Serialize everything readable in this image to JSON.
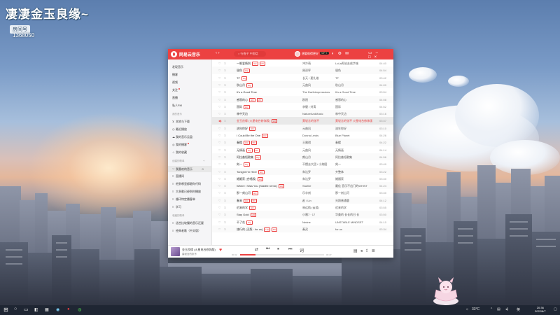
{
  "overlay": {
    "stream_title": "凄凄金玉良缘~",
    "room_label": "房间号",
    "room_number": "1368050"
  },
  "app": {
    "name": "网易云音乐",
    "search_placeholder": "○ 行香子 中国话",
    "user_name": "想要做得更好",
    "vip": "VIP 7",
    "brand_color": "#ec4141"
  },
  "sidebar": {
    "top_items": [
      "发现音乐",
      "播客",
      "视频",
      "关注",
      "直播",
      "私人FM"
    ],
    "mine_header": "我的音乐",
    "mine_items": [
      "本地与下载",
      "最近播放",
      "我的音乐云盘",
      "我的播客",
      "我的收藏"
    ],
    "created_header": "创建的歌单",
    "created_items": [
      "我喜欢的音乐",
      "直播间",
      "他到哪里都跟你代码",
      "大多歌已经到时播放",
      "循环特定播客单",
      "学习"
    ],
    "collected_header": "收藏的歌单",
    "collected_items": [
      "适合比较慢的音乐还要",
      "经典老歌（中文版）"
    ]
  },
  "songs": [
    {
      "title": "一眼爱情到",
      "tags": [
        "HQ",
        "MV"
      ],
      "artist": "冲冷萌",
      "album": "LoLa再站去成华城",
      "duration": "04:40"
    },
    {
      "title": "银色",
      "tags": [
        "HQ"
      ],
      "artist": "周深哼",
      "album": "银色",
      "duration": "04:54"
    },
    {
      "title": "TF",
      "tags": [
        "HQ"
      ],
      "artist": "长天 / 夏扎维",
      "album": "TF",
      "duration": "03:42"
    },
    {
      "title": "秋山月",
      "tags": [
        "HQ"
      ],
      "artist": "元曲风",
      "album": "秋山月",
      "duration": "04:00"
    },
    {
      "title": "It's a Good Time",
      "tags": [],
      "artist": "The Darthimpressions",
      "album": "It's a Good Time",
      "duration": "03:54"
    },
    {
      "title": "感恩的心",
      "tags": [
        "HQ",
        "MV"
      ],
      "artist": "欧阳",
      "album": "感恩的心",
      "duration": "04:08"
    },
    {
      "title": "国际",
      "tags": [
        "HQ"
      ],
      "artist": "李健 / 刘涛",
      "album": "国际",
      "duration": "04:52"
    },
    {
      "title": "林中天边",
      "tags": [],
      "artist": "NatureAndMusic",
      "album": "林中天边",
      "duration": "03:16"
    },
    {
      "title": "金玉良缘 (火星电台修饰版)",
      "tags": [
        "HQ"
      ],
      "artist": "莫轻言的张不",
      "album": "莫轻言的张不 火星电台修饰版",
      "duration": "03:47"
    },
    {
      "title": "流年你好",
      "tags": [
        "HQ"
      ],
      "artist": "元曲风",
      "album": "流年你好",
      "duration": "03:10"
    },
    {
      "title": "I Could Be the One",
      "tags": [
        "HQ"
      ],
      "artist": "Donna Lewis",
      "album": "Blue Planet",
      "duration": "04:26"
    },
    {
      "title": "春樱",
      "tags": [
        "HQ",
        "MV"
      ],
      "artist": "王雅琪",
      "album": "春樱",
      "duration": "04:22"
    },
    {
      "title": "无情画",
      "tags": [
        "HQ",
        "MV"
      ],
      "artist": "元曲风",
      "album": "无情画",
      "duration": "04:14"
    },
    {
      "title": "阿拉善短歌集",
      "tags": [
        "HQ"
      ],
      "artist": "朗山月",
      "album": "阿拉善短歌集",
      "duration": "04:56"
    },
    {
      "title": "刻一",
      "tags": [
        "HQ"
      ],
      "artist": "不懂去大团 / 小刻图",
      "album": "刻一",
      "duration": "03:49"
    },
    {
      "title": "Tonight I'm Here",
      "tags": [
        "HQ"
      ],
      "artist": "朱达罗",
      "album": "齐整体",
      "duration": "03:22"
    },
    {
      "title": "婚姻家 (合唱版)",
      "tags": [
        "HQ"
      ],
      "artist": "朱达罗",
      "album": "婚姻家",
      "duration": "03:40"
    },
    {
      "title": "Where I Was You (Starlite remix)",
      "tags": [
        "HQ"
      ],
      "artist": "Starlite",
      "album": "最佳 音乐不出门的WHIST",
      "duration": "04:24"
    },
    {
      "title": "那一刻山河",
      "tags": [
        "HQ"
      ],
      "artist": "乐字刻",
      "album": "那一刻山河",
      "duration": "03:40"
    },
    {
      "title": "春来",
      "tags": [
        "HQ",
        "MV"
      ],
      "artist": "赵 / Lin",
      "album": "光照普通鹿",
      "duration": "04:12"
    },
    {
      "title": "迟来的学",
      "tags": [
        "HQ"
      ],
      "artist": "林远航 (云游)",
      "album": "迟来的学",
      "duration": "03:55"
    },
    {
      "title": "Stay Gold",
      "tags": [
        "HQ"
      ],
      "artist": "小雅7 · 17",
      "album": "华美的 长长的日 长",
      "duration": "03:50"
    },
    {
      "title": "不了花",
      "tags": [
        "HQ"
      ],
      "artist": "Nerine",
      "album": "UNSTABLE MINDSET",
      "duration": "04:10"
    },
    {
      "title": "旅行的 (汉版 · for us)",
      "tags": [
        "HQ",
        "MV"
      ],
      "artist": "秦灵",
      "album": "for us",
      "duration": "03:34"
    }
  ],
  "now_playing": {
    "title": "金玉良缘 (火星电台修饰版)",
    "artist": "莫轻言的张不",
    "elapsed": "00:42",
    "total": "03:47",
    "progress": 0.18
  },
  "taskbar": {
    "clock_time": "20:36",
    "clock_date": "2022/8/7",
    "temperature": "33°C",
    "ime": "英"
  }
}
